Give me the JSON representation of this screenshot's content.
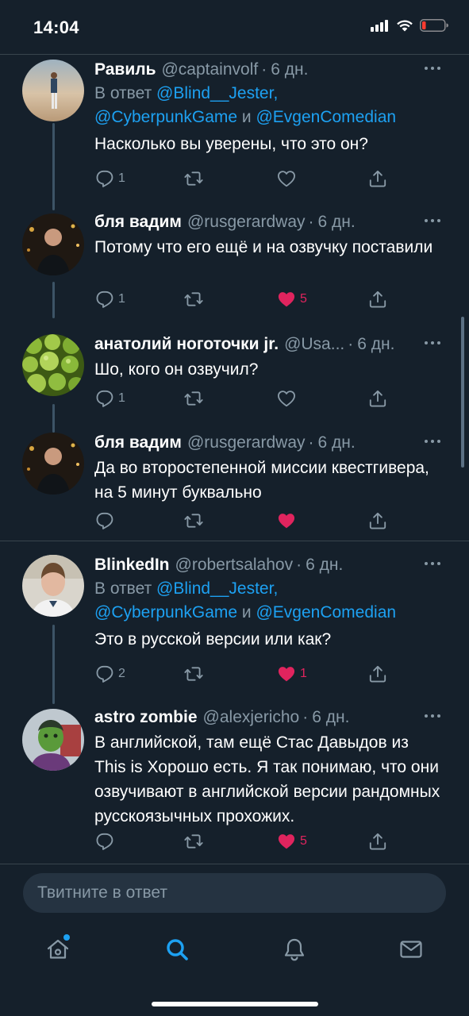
{
  "status_bar": {
    "time": "14:04"
  },
  "colors": {
    "background": "#15202b",
    "accent": "#1da1f2",
    "like": "#e0245e",
    "secondary": "#8899a6"
  },
  "tweets": [
    {
      "name": "Равиль",
      "handle": "@captainvolf",
      "time": "6 дн.",
      "reply_prefix": "В ответ ",
      "reply_line1": "@Blind__Jester,",
      "reply_line2a": "@CyberpunkGame",
      "reply_and": " и ",
      "reply_line2b": "@EvgenComedian",
      "text": "Насколько вы уверены, что это он?",
      "replies": "1",
      "retweets": "",
      "likes": "",
      "liked": false
    },
    {
      "name": "бля вадим",
      "handle": "@rusgerardway",
      "time": "6 дн.",
      "text": "Потому что его ещё и на озвучку поставили",
      "replies": "1",
      "retweets": "",
      "likes": "5",
      "liked": true
    },
    {
      "name": "анатолий ноготочки jr.",
      "handle": "@Usa...",
      "time": "6 дн.",
      "text": "Шо, кого он озвучил?",
      "replies": "1",
      "retweets": "",
      "likes": "",
      "liked": false
    },
    {
      "name": "бля вадим",
      "handle": "@rusgerardway",
      "time": "6 дн.",
      "text": "Да во второстепенной миссии квестгивера, на 5 минут буквально",
      "replies": "",
      "retweets": "",
      "likes": "",
      "liked": true
    },
    {
      "name": "BlinkedIn",
      "handle": "@robertsalahov",
      "time": "6 дн.",
      "reply_prefix": "В ответ ",
      "reply_line1": "@Blind__Jester,",
      "reply_line2a": "@CyberpunkGame",
      "reply_and": " и ",
      "reply_line2b": "@EvgenComedian",
      "text": "Это в русской версии или как?",
      "replies": "2",
      "retweets": "",
      "likes": "1",
      "liked": true
    },
    {
      "name": "astro zombie",
      "handle": "@alexjericho",
      "time": "6 дн.",
      "text": "В английской, там ещё Стас Давыдов из This is Хорошо есть. Я так понимаю, что они озвучивают в английской версии рандомных русскоязычных прохожих.",
      "replies": "",
      "retweets": "",
      "likes": "5",
      "liked": true
    }
  ],
  "reply_bar": {
    "placeholder": "Твитните в ответ"
  },
  "tab_bar": {
    "items": [
      "home-icon",
      "search-icon",
      "notifications-icon",
      "messages-icon"
    ],
    "active": "search-icon"
  }
}
